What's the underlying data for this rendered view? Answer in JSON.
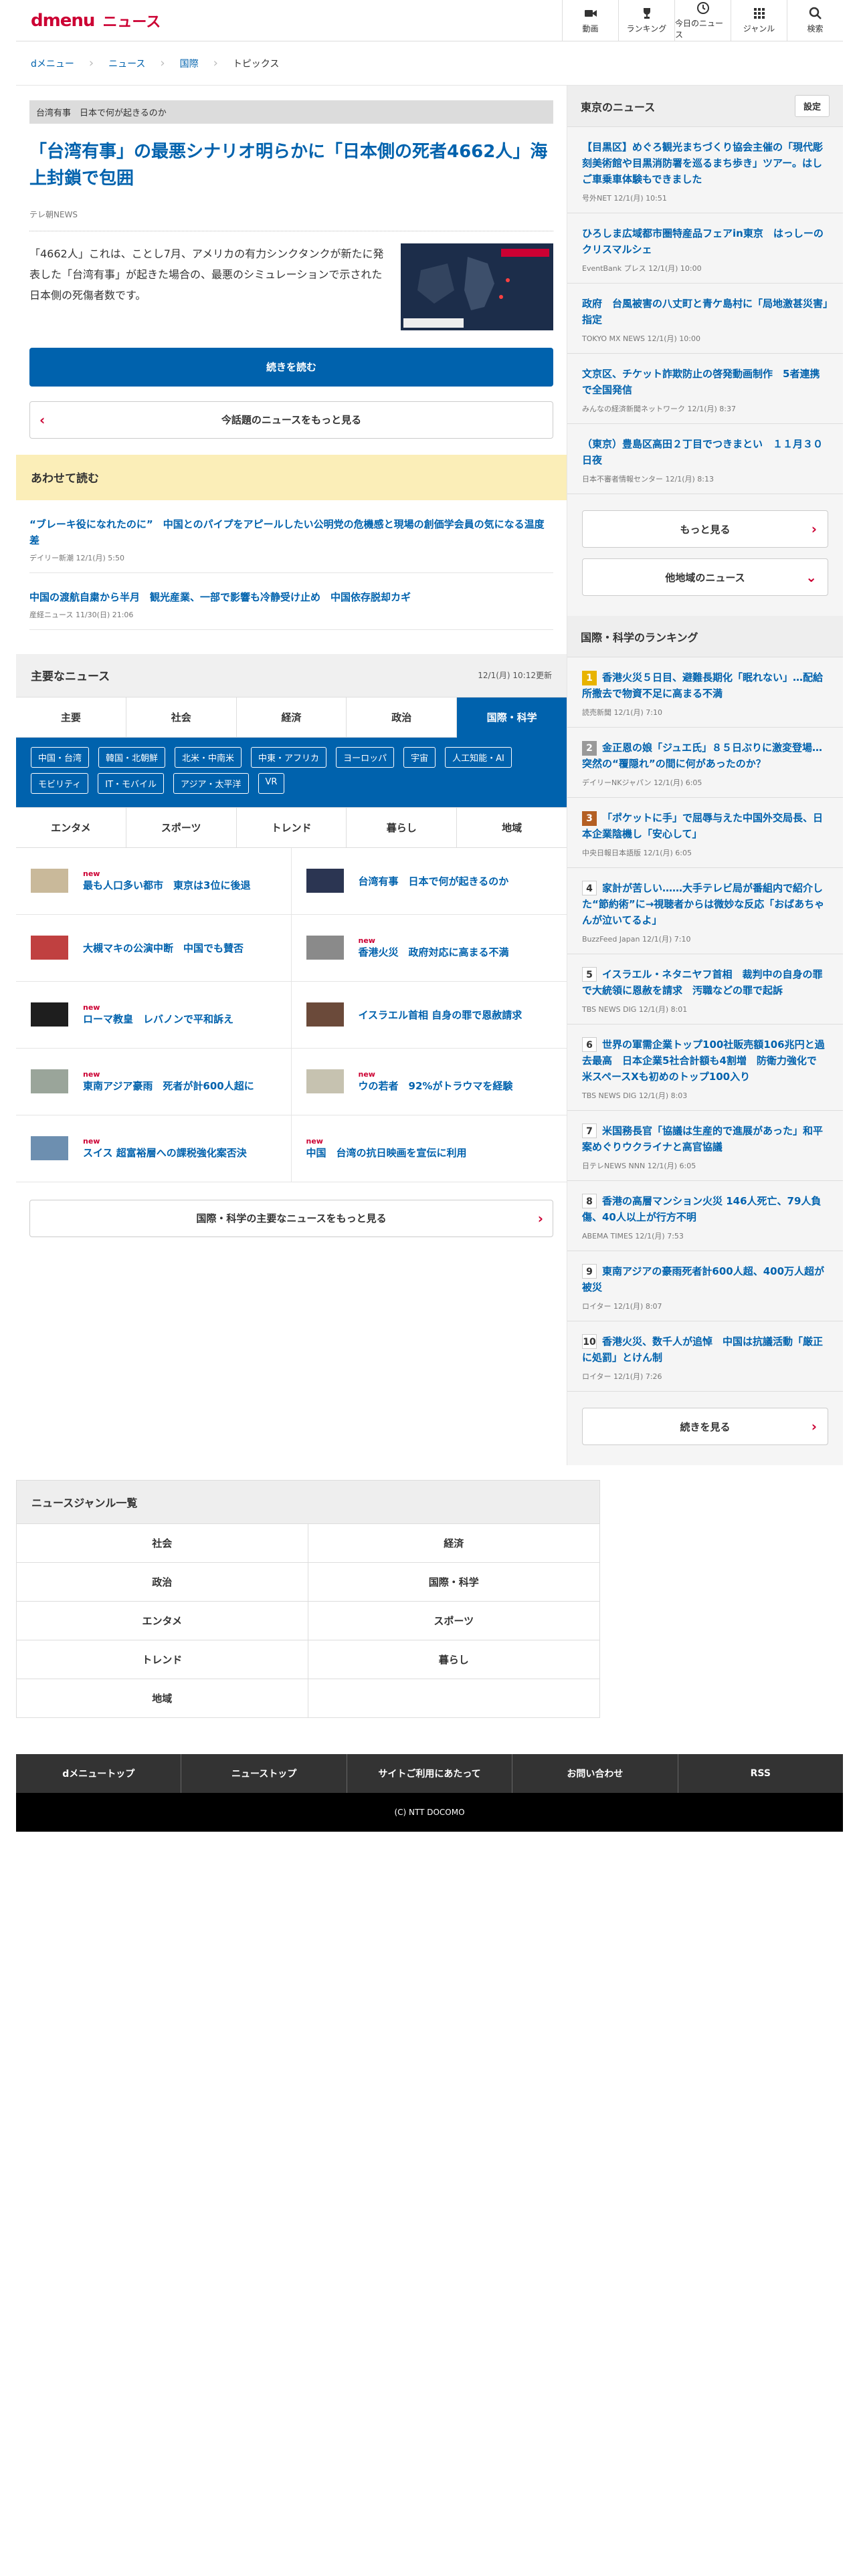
{
  "header": {
    "logo": "dmenu",
    "service": "ニュース",
    "nav": [
      {
        "label": "動画",
        "icon": "video-icon"
      },
      {
        "label": "ランキング",
        "icon": "trophy-icon"
      },
      {
        "label": "今日のニュース",
        "icon": "clock-icon"
      },
      {
        "label": "ジャンル",
        "icon": "grid-icon"
      },
      {
        "label": "検索",
        "icon": "search-icon"
      }
    ]
  },
  "breadcrumb": [
    "dメニュー",
    "ニュース",
    "国際",
    "トピックス"
  ],
  "article": {
    "tag": "台湾有事　日本で何が起きるのか",
    "title": "「台湾有事」の最悪シナリオ明らかに「日本側の死者4662人」海上封鎖で包囲",
    "source": "テレ朝NEWS",
    "lead": "「4662人」これは、ことし7月、アメリカの有力シンクタンクが新たに発表した「台湾有事」が起きた場合の、最悪のシミュレーションで示された日本側の死傷者数です。",
    "read_more": "続きを読む",
    "more_topic": "今話題のニュースをもっと見る"
  },
  "also": {
    "title": "あわせて読む",
    "items": [
      {
        "title": "“ブレーキ役になれたのに”　中国とのパイプをアピールしたい公明党の危機感と現場の創価学会員の気になる温度差",
        "meta": "デイリー新潮 12/1(月) 5:50"
      },
      {
        "title": "中国の渡航自粛から半月　観光産業、一部で影響も冷静受け止め　中国依存脱却カギ",
        "meta": "産経ニュース 11/30(日) 21:06"
      }
    ]
  },
  "major": {
    "title": "主要なニュース",
    "updated": "12/1(月) 10:12更新",
    "tabs": [
      "主要",
      "社会",
      "経済",
      "政治",
      "国際・科学"
    ],
    "chips": [
      "中国・台湾",
      "韓国・北朝鮮",
      "北米・中南米",
      "中東・アフリカ",
      "ヨーロッパ",
      "宇宙",
      "人工知能・AI",
      "モビリティ",
      "IT・モバイル",
      "アジア・太平洋",
      "VR"
    ],
    "tabs2": [
      "エンタメ",
      "スポーツ",
      "トレンド",
      "暮らし",
      "地域"
    ],
    "new_label": "new",
    "items": [
      {
        "title": "最も人口多い都市　東京は3位に後退",
        "new": true
      },
      {
        "title": "台湾有事　日本で何が起きるのか",
        "new": false
      },
      {
        "title": "大槻マキの公演中断　中国でも賛否",
        "new": false
      },
      {
        "title": "香港火災　政府対応に高まる不満",
        "new": true
      },
      {
        "title": "ローマ教皇　レバノンで平和訴え",
        "new": true
      },
      {
        "title": "イスラエル首相 自身の罪で恩赦請求",
        "new": false
      },
      {
        "title": "東南アジア豪雨　死者が計600人超に",
        "new": true
      },
      {
        "title": "ウの若者　92%がトラウマを経験",
        "new": true
      },
      {
        "title": "スイス 超富裕層への課税強化案否決",
        "new": true
      },
      {
        "title": "中国　台湾の抗日映画を宣伝に利用",
        "new": true
      }
    ],
    "more": "国際・科学の主要なニュースをもっと見る"
  },
  "tokyo": {
    "title": "東京のニュース",
    "setting": "設定",
    "items": [
      {
        "title": "【目黒区】めぐろ観光まちづくり協会主催の「現代彫刻美術館や目黒消防署を巡るまち歩き」ツアー。はしご車乗車体験もできました",
        "meta": "号外NET 12/1(月) 10:51"
      },
      {
        "title": "ひろしま広域都市圏特産品フェアin東京　はっしーのクリスマルシェ",
        "meta": "EventBank プレス 12/1(月) 10:00"
      },
      {
        "title": "政府　台風被害の八丈町と青ケ島村に「局地激甚災害」指定",
        "meta": "TOKYO MX NEWS 12/1(月) 10:00"
      },
      {
        "title": "文京区、チケット詐欺防止の啓発動画制作　5者連携で全国発信",
        "meta": "みんなの経済新聞ネットワーク 12/1(月) 8:37"
      },
      {
        "title": "（東京）豊島区高田２丁目でつきまとい　１１月３０日夜",
        "meta": "日本不審者情報センター 12/1(月) 8:13"
      }
    ],
    "more": "もっと見る",
    "other": "他地域のニュース"
  },
  "ranking": {
    "title": "国際・科学のランキング",
    "items": [
      {
        "rank": "1",
        "title": "香港火災５日目、避難長期化「眠れない」…配給所撒去で物資不足に高まる不満",
        "meta": "読売新聞 12/1(月) 7:10"
      },
      {
        "rank": "2",
        "title": "金正恩の娘「ジュエ氏」８５日ぶりに激変登場…突然の“覆隠れ”の間に何があったのか？",
        "meta": "デイリーNKジャパン 12/1(月) 6:05"
      },
      {
        "rank": "3",
        "title": "「ポケットに手」で屈辱与えた中国外交局長、日本企業陰機し「安心して」",
        "meta": "中央日報日本語版 12/1(月) 6:05"
      },
      {
        "rank": "4",
        "title": "家計が苦しい……大手テレビ局が番組内で紹介した“節約術”に→視聴者からは微妙な反応「おばあちゃんが泣いてるよ」",
        "meta": "BuzzFeed Japan 12/1(月) 7:10"
      },
      {
        "rank": "5",
        "title": "イスラエル・ネタニヤフ首相　裁判中の自身の罪で大統領に恩赦を請求　汚職などの罪で起訴",
        "meta": "TBS NEWS DIG 12/1(月) 8:01"
      },
      {
        "rank": "6",
        "title": "世界の軍需企業トップ100社販売額106兆円と過去最高　日本企業5社合計額も4割増　防衛力強化で　米スペースXも初めのトップ100入り",
        "meta": "TBS NEWS DIG 12/1(月) 8:03"
      },
      {
        "rank": "7",
        "title": "米国務長官「協議は生産的で進展があった」和平案めぐりウクライナと高官協議",
        "meta": "日テレNEWS NNN 12/1(月) 6:05"
      },
      {
        "rank": "8",
        "title": "香港の高層マンション火災 146人死亡、79人負傷、40人以上が行方不明",
        "meta": "ABEMA TIMES 12/1(月) 7:53"
      },
      {
        "rank": "9",
        "title": "東南アジアの豪雨死者計600人超、400万人超が被災",
        "meta": "ロイター 12/1(月) 8:07"
      },
      {
        "rank": "10",
        "title": "香港火災、数千人が追悼　中国は抗議活動「厳正に処罰」とけん制",
        "meta": "ロイター 12/1(月) 7:26"
      }
    ],
    "more": "続きを見る"
  },
  "genre": {
    "title": "ニュースジャンル一覧",
    "items": [
      "社会",
      "経済",
      "政治",
      "国際・科学",
      "エンタメ",
      "スポーツ",
      "トレンド",
      "暮らし",
      "地域",
      ""
    ]
  },
  "footer": {
    "nav": [
      "dメニュートップ",
      "ニューストップ",
      "サイトご利用にあたって",
      "お問い合わせ",
      "RSS"
    ],
    "copyright": "(C) NTT DOCOMO"
  }
}
